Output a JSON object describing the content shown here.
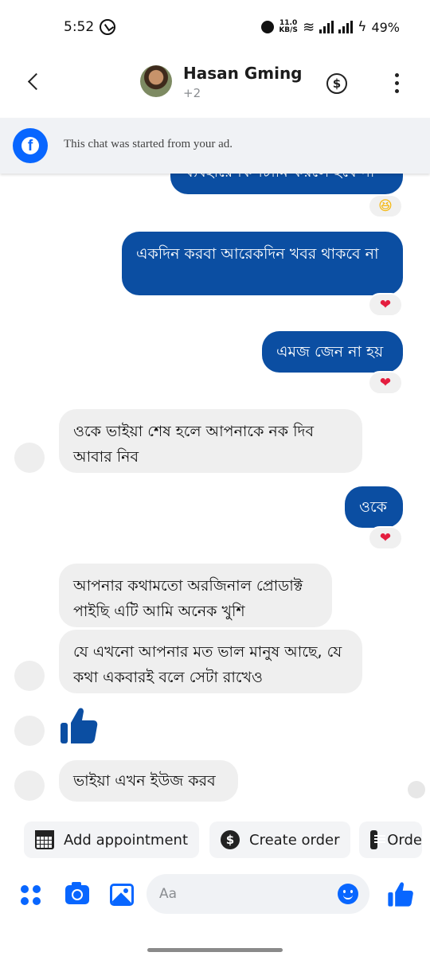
{
  "status_bar": {
    "time": "5:52",
    "speed_value": "11.0",
    "speed_unit": "KB/S",
    "battery": "49%"
  },
  "header": {
    "contact_name": "Hasan Gming",
    "contact_subtitle": "+2",
    "icons": [
      "back-arrow-icon",
      "dollar-icon",
      "more-vertical-icon"
    ]
  },
  "banner": {
    "text": "This chat was started from your ad."
  },
  "messages": [
    {
      "side": "out",
      "text": "ব্যবহারে কিপটামি করলে হবে না",
      "reaction": "😆"
    },
    {
      "side": "out",
      "text": "একদিন করবা আরেকদিন খবর থাকবে না",
      "reaction": "❤"
    },
    {
      "side": "out",
      "text": "এমজ জেন না হয়",
      "reaction": "❤"
    },
    {
      "side": "in",
      "text": "ওকে ভাইয়া শেষ হলে আপনাকে নক দিব আবার নিব"
    },
    {
      "side": "out",
      "text": "ওকে",
      "reaction": "❤"
    },
    {
      "side": "in",
      "text": "আপনার কথামতো অরজিনাল প্রোডাক্ট পাইছি এটি আমি অনেক খুশি"
    },
    {
      "side": "in",
      "text": "যে এখনো আপনার মত ভাল মানুষ আছে, যে কথা একবারই বলে সেটা রাখেও"
    },
    {
      "side": "in",
      "type": "like"
    },
    {
      "side": "in",
      "text": "ভাইয়া এখন ইউজ করব"
    }
  ],
  "quick_actions": [
    {
      "label": "Add appointment",
      "icon": "calendar-icon"
    },
    {
      "label": "Create order",
      "icon": "dollar-circle-icon"
    },
    {
      "label": "Orde",
      "icon": "order-list-icon"
    }
  ],
  "composer": {
    "placeholder": "Aa"
  },
  "colors": {
    "outgoing_bubble": "#0b4ea2",
    "incoming_bubble": "#efefef",
    "accent": "#0866ff",
    "heart": "#e41e3f"
  }
}
